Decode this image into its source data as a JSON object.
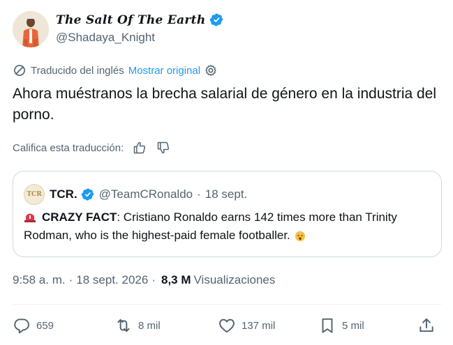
{
  "author": {
    "display_name": "The Salt Of The Earth",
    "handle": "@Shadaya_Knight",
    "verified_icon": "verified-badge-icon"
  },
  "translation": {
    "translated_label": "Traducido del inglés",
    "show_original_label": "Mostrar original",
    "accent": "#1d9bf0"
  },
  "tweet": {
    "text": "Ahora muéstranos la brecha salarial de género en la industria del porno."
  },
  "rate_translation": {
    "label": "Califica esta traducción:"
  },
  "quote": {
    "avatar_text": "TCR",
    "name": "TCR.",
    "handle": "@TeamCRonaldo",
    "separator": "·",
    "date": "18 sept.",
    "fact_label": "CRAZY FACT",
    "body": ": Cristiano Ronaldo earns 142 times more than Trinity Rodman, who is the highest-paid female footballer."
  },
  "meta": {
    "time": "9:58 a. m.",
    "separator": "·",
    "date": "18 sept. 2026",
    "views_count": "8,3 M",
    "views_label": "Visualizaciones"
  },
  "actions": {
    "replies": "659",
    "reposts": "8 mil",
    "likes": "137 mil",
    "bookmarks": "5 mil"
  }
}
